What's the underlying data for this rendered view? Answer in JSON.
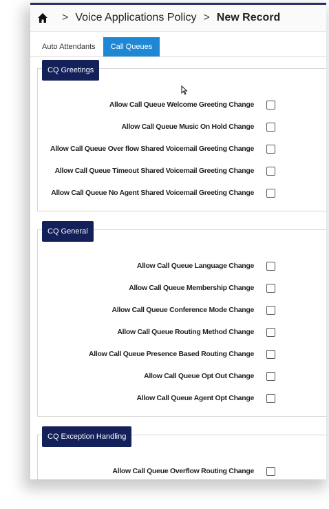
{
  "breadcrumb": {
    "home_icon": "home-icon",
    "separator": ">",
    "parent": "Voice Applications Policy",
    "current": "New Record"
  },
  "tabs": [
    {
      "label": "Auto Attendants",
      "active": false
    },
    {
      "label": "Call Queues",
      "active": true
    }
  ],
  "sections": [
    {
      "title": "CQ Greetings",
      "items": [
        "Allow Call Queue Welcome Greeting Change",
        "Allow Call Queue Music On Hold Change",
        "Allow Call Queue Over flow Shared Voicemail Greeting Change",
        "Allow Call Queue Timeout Shared Voicemail Greeting Change",
        "Allow Call Queue No Agent Shared Voicemail Greeting Change"
      ]
    },
    {
      "title": "CQ General",
      "items": [
        "Allow Call Queue Language Change",
        "Allow Call Queue Membership Change",
        "Allow Call Queue Conference Mode Change",
        "Allow Call Queue Routing Method Change",
        "Allow Call Queue Presence Based Routing Change",
        "Allow Call Queue Opt Out Change",
        "Allow Call Queue Agent Opt Change"
      ]
    },
    {
      "title": "CQ Exception Handling",
      "items": [
        "Allow Call Queue Overflow Routing Change"
      ]
    }
  ],
  "colors": {
    "active_tab": "#1f88d4",
    "section_badge": "#13205a"
  }
}
